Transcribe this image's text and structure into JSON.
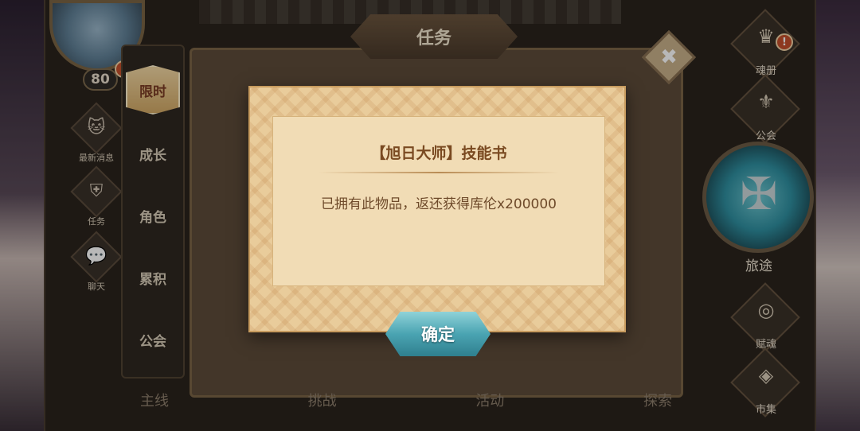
{
  "panel": {
    "title": "任务",
    "level": "80",
    "alert_mark": "!"
  },
  "left_mini": [
    {
      "label": "最新消息",
      "icon": "cat-icon"
    },
    {
      "label": "任务",
      "icon": "shield-icon"
    },
    {
      "label": "聊天",
      "icon": "chat-icon"
    }
  ],
  "tabs": [
    {
      "label": "限时",
      "active": true
    },
    {
      "label": "成长"
    },
    {
      "label": "角色"
    },
    {
      "label": "累积"
    },
    {
      "label": "公会"
    }
  ],
  "right_menu": [
    {
      "label": "魂册"
    },
    {
      "label": "公会"
    },
    {
      "label": "旅途"
    },
    {
      "label": "赋魂"
    },
    {
      "label": "市集"
    }
  ],
  "bottom_tabs": [
    "主线",
    "挑战",
    "活动",
    "探索"
  ],
  "dialog": {
    "title": "【旭日大师】技能书",
    "message": "已拥有此物品，返还获得库伦x200000",
    "confirm_label": "确定"
  },
  "colors": {
    "parchment": "#e9cc9b",
    "confirm": "#4aa4b2",
    "accent": "#c4502b"
  }
}
